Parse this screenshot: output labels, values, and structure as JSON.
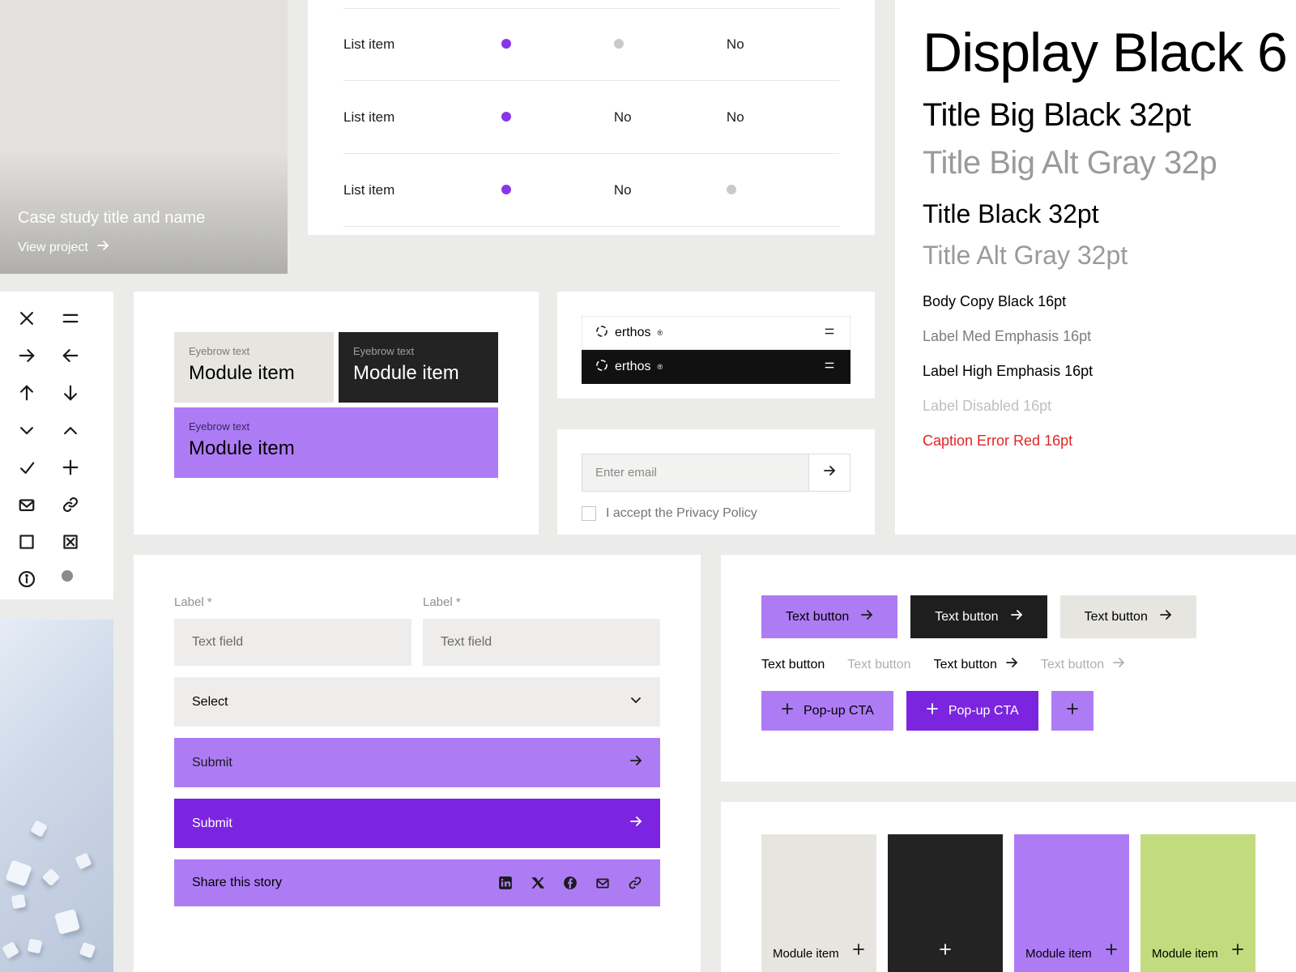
{
  "case_study": {
    "title": "Case study title and name",
    "link": "View project"
  },
  "list_table": {
    "rows": [
      {
        "label": "List item",
        "c1": "dot-purple",
        "c2": "dot-gray",
        "c3": "No"
      },
      {
        "label": "List item",
        "c1": "dot-purple",
        "c2": "No",
        "c3": "No"
      },
      {
        "label": "List item",
        "c1": "dot-purple",
        "c2": "No",
        "c3": "dot-gray"
      }
    ]
  },
  "typography": {
    "display": "Display Black 6",
    "title_big_black": "Title Big Black 32pt",
    "title_big_gray": "Title Big Alt Gray 32p",
    "title_black": "Title Black 32pt",
    "title_gray": "Title Alt Gray 32pt",
    "body": "Body Copy Black 16pt",
    "label_med": "Label Med Emphasis 16pt",
    "label_high": "Label High Emphasis 16pt",
    "label_disabled": "Label Disabled 16pt",
    "caption_error": "Caption Error Red 16pt"
  },
  "modules": {
    "eyebrow": "Eyebrow text",
    "title": "Module item"
  },
  "headers": {
    "brand": "erthos",
    "reg": "®"
  },
  "email": {
    "placeholder": "Enter email",
    "privacy": "I accept the Privacy Policy"
  },
  "form": {
    "label": "Label *",
    "text_field": "Text field",
    "select": "Select",
    "submit": "Submit",
    "share": "Share this story"
  },
  "buttons": {
    "text_button": "Text button",
    "popup": "Pop-up CTA"
  },
  "swatches": {
    "label": "Module item"
  },
  "colors": {
    "purple_accent": "#8936ea",
    "lilac": "#ad7cf5",
    "deep_purple": "#7b25e0",
    "lime": "#c2db7e",
    "dark": "#232323",
    "warm_gray": "#e6e5e0",
    "error_red": "#e32424"
  }
}
